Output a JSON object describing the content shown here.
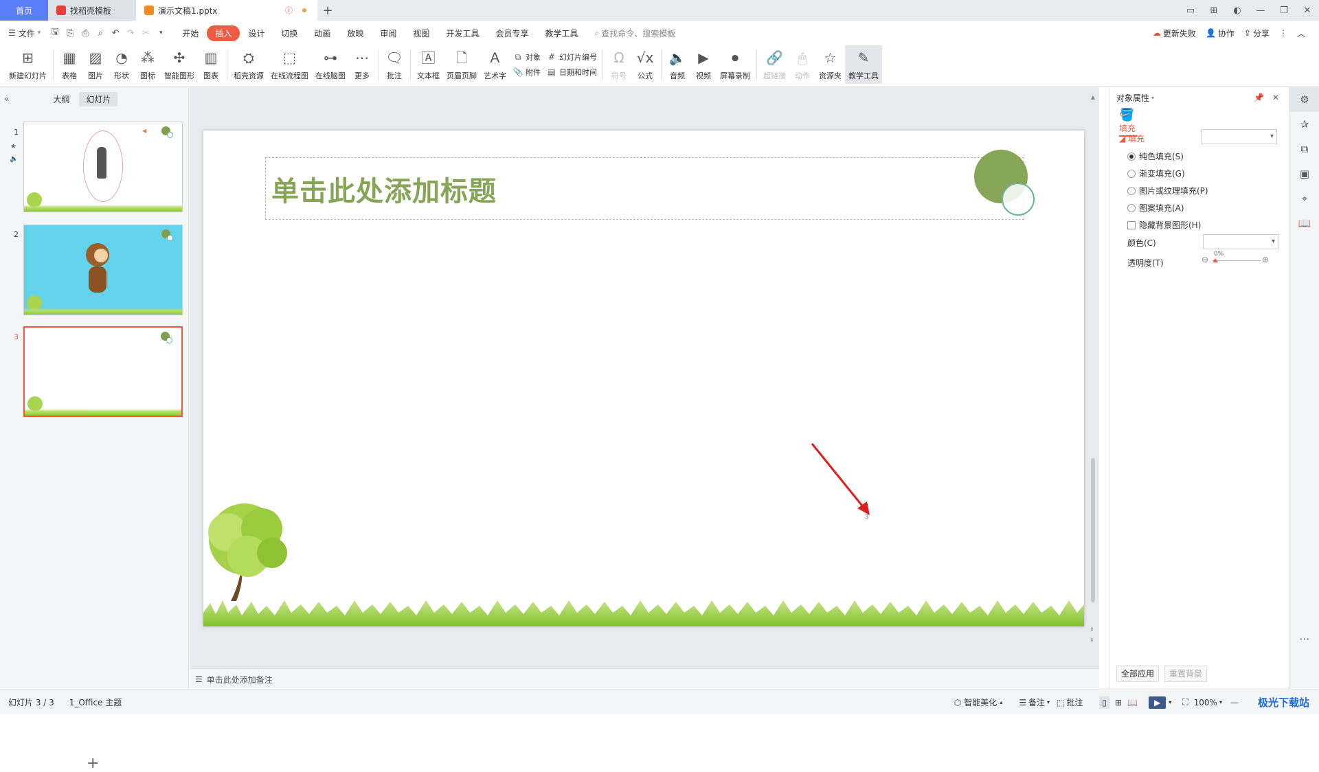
{
  "tabs": {
    "home": "首页",
    "template": "找稻壳模板",
    "document": "演示文稿1.pptx",
    "warn": "⓵",
    "new_tab": "+"
  },
  "window_controls": [
    "▭",
    "⊞",
    "◐",
    "—",
    "❐",
    "✕"
  ],
  "menu": {
    "file": "文件",
    "items": [
      "开始",
      "插入",
      "设计",
      "切换",
      "动画",
      "放映",
      "审阅",
      "视图",
      "开发工具",
      "会员专享",
      "教学工具"
    ],
    "active_index": 1,
    "search": "查找命令、搜索模板",
    "right": [
      "更新失败",
      "协作",
      "分享"
    ]
  },
  "ribbon": {
    "new_slide": "新建幻灯片",
    "table": "表格",
    "picture": "图片",
    "shape": "形状",
    "icon": "图标",
    "smart_art": "智能图形",
    "chart": "图表",
    "daoke": "稻壳资源",
    "flowchart": "在线流程图",
    "mindmap": "在线脑图",
    "more": "更多",
    "comment": "批注",
    "textbox": "文本框",
    "header_footer": "页眉页脚",
    "wordart": "艺术字",
    "object": "对象",
    "slide_number": "幻灯片编号",
    "attachment": "附件",
    "datetime": "日期和时间",
    "symbol": "符号",
    "formula": "公式",
    "audio": "音频",
    "video": "视频",
    "screen_record": "屏幕录制",
    "hyperlink": "超链接",
    "action": "动作",
    "resource": "资源夹",
    "teaching": "教学工具"
  },
  "left_pane": {
    "outline": "大纲",
    "slides": "幻灯片",
    "slide_numbers": [
      "1",
      "2",
      "3"
    ],
    "selected": 3
  },
  "slide": {
    "title_placeholder": "单击此处添加标题",
    "page_number": "3",
    "accent": "#87a556"
  },
  "notes_placeholder": "单击此处添加备注",
  "right_panel": {
    "title": "对象属性",
    "fill_tab": "填充",
    "section": "填充",
    "options": [
      "纯色填充(S)",
      "渐变填充(G)",
      "图片或纹理填充(P)",
      "图案填充(A)"
    ],
    "selected_option": 0,
    "hide_bg": "隐藏背景图形(H)",
    "color_label": "颜色(C)",
    "transparency_label": "透明度(T)",
    "transparency_value": "0%",
    "apply_all": "全部应用",
    "reset_bg": "重置背景"
  },
  "status": {
    "slide_info": "幻灯片 3 / 3",
    "theme": "1_Office 主题",
    "beautify": "智能美化",
    "notes": "备注",
    "comment": "批注",
    "zoom": "100%",
    "watermark": "极光下载站"
  }
}
